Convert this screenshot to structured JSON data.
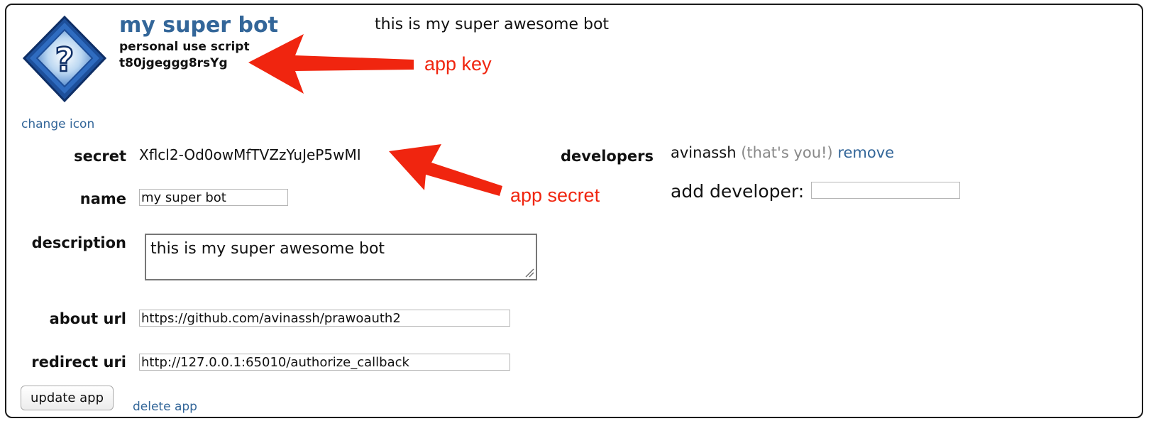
{
  "app": {
    "name": "my super bot",
    "type": "personal use script",
    "key": "t80jgeggg8rsYg",
    "summary": "this is my super awesome bot",
    "change_icon_label": "change icon",
    "icon": "question-mark-diamond-icon"
  },
  "form": {
    "secret_label": "secret",
    "secret_value": "Xflcl2-Od0owMfTVZzYuJeP5wMI",
    "name_label": "name",
    "name_value": "my super bot",
    "description_label": "description",
    "description_value": "this is my super awesome bot",
    "about_url_label": "about url",
    "about_url_value": "https://github.com/avinassh/prawoauth2",
    "redirect_uri_label": "redirect uri",
    "redirect_uri_value": "http://127.0.0.1:65010/authorize_callback"
  },
  "developers": {
    "label": "developers",
    "name": "avinassh",
    "note": "(that's you!)",
    "remove_label": "remove",
    "add_label": "add developer:",
    "add_value": ""
  },
  "actions": {
    "update_label": "update app",
    "delete_label": "delete app"
  },
  "annotations": {
    "key_label": "app key",
    "secret_label": "app secret",
    "color": "#f0250f"
  },
  "colors": {
    "link": "#336699",
    "title": "#336699",
    "muted": "#888888"
  }
}
